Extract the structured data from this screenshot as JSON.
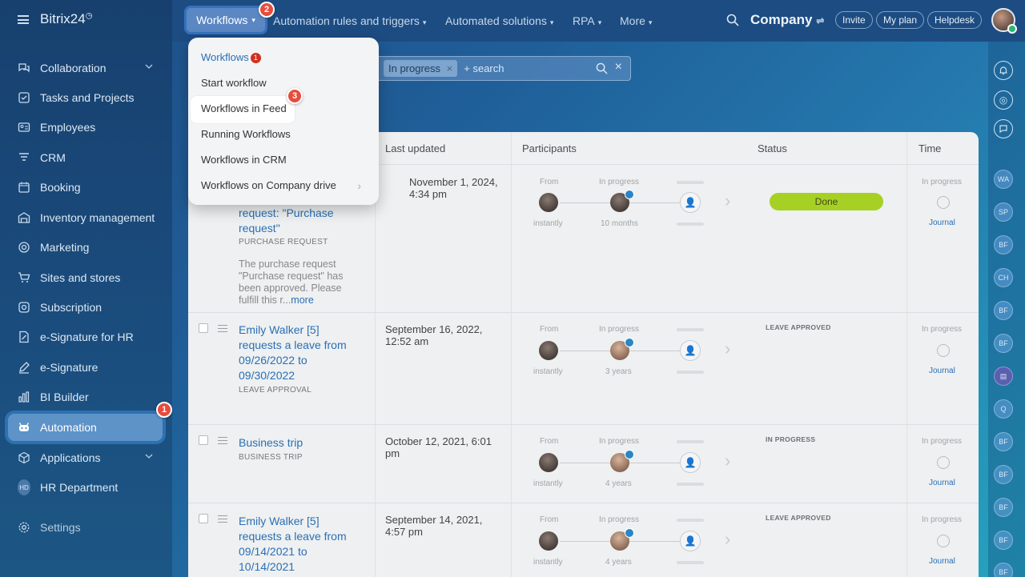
{
  "app": {
    "name": "Bitrix24"
  },
  "sidebar": {
    "items": [
      {
        "label": "Collaboration",
        "icon": "chat-bubbles-icon",
        "has_chevron": true
      },
      {
        "label": "Tasks and Projects",
        "icon": "checkbox-icon"
      },
      {
        "label": "Employees",
        "icon": "id-card-icon"
      },
      {
        "label": "CRM",
        "icon": "funnel-icon"
      },
      {
        "label": "Booking",
        "icon": "calendar-icon"
      },
      {
        "label": "Inventory management",
        "icon": "warehouse-icon"
      },
      {
        "label": "Marketing",
        "icon": "target-icon"
      },
      {
        "label": "Sites and stores",
        "icon": "cart-icon"
      },
      {
        "label": "Subscription",
        "icon": "subscription-icon"
      },
      {
        "label": "e-Signature for HR",
        "icon": "document-sign-icon"
      },
      {
        "label": "e-Signature",
        "icon": "pen-icon"
      },
      {
        "label": "BI Builder",
        "icon": "bar-chart-icon"
      },
      {
        "label": "Automation",
        "icon": "robot-icon",
        "active": true
      },
      {
        "label": "Applications",
        "icon": "cube-icon",
        "has_chevron": true
      },
      {
        "label": "HR Department",
        "icon": "hd-avatar",
        "badge": "HD"
      },
      {
        "label": "Settings",
        "icon": "gear-icon"
      }
    ]
  },
  "topbar": {
    "tabs": [
      {
        "label": "Workflows"
      },
      {
        "label": "Automation rules and triggers"
      },
      {
        "label": "Automated solutions"
      },
      {
        "label": "RPA"
      },
      {
        "label": "More"
      }
    ],
    "company": "Company",
    "buttons": {
      "invite": "Invite",
      "plan": "My plan",
      "helpdesk": "Helpdesk"
    }
  },
  "steps": {
    "one": "1",
    "two": "2",
    "three": "3"
  },
  "filter": {
    "chip": "In progress",
    "placeholder": "+ search"
  },
  "menu": {
    "items": [
      {
        "label": "Workflows",
        "count": "1"
      },
      {
        "label": "Start workflow"
      },
      {
        "label": "Workflows in Feed"
      },
      {
        "label": "Running Workflows"
      },
      {
        "label": "Workflows in CRM"
      },
      {
        "label": "Workflows on Company drive"
      }
    ]
  },
  "table": {
    "headers": {
      "updated": "Last updated",
      "participants": "Participants",
      "status": "Status",
      "time": "Time"
    },
    "labels": {
      "from": "From",
      "in_progress": "In progress",
      "instantly": "instantly",
      "journal": "Journal"
    },
    "rows": [
      {
        "title": "request: \"Purchase request\"",
        "type": "PURCHASE REQUEST",
        "desc": "The purchase request \"Purchase request\" has been approved. Please fulfill this r...",
        "more": "more",
        "date": "November 1, 2024, 4:34 pm",
        "duration": "10 months",
        "status": "Done"
      },
      {
        "title": "Emily Walker [5] requests a leave from 09/26/2022 to 09/30/2022",
        "type": "LEAVE APPROVAL",
        "date": "September 16, 2022, 12:52 am",
        "duration": "3 years",
        "status": "LEAVE APPROVED"
      },
      {
        "title": "Business trip",
        "type": "BUSINESS TRIP",
        "date": "October 12, 2021, 6:01 pm",
        "duration": "4 years",
        "status": "IN PROGRESS"
      },
      {
        "title": "Emily Walker [5] requests a leave from 09/14/2021 to 10/14/2021",
        "date": "September 14, 2021, 4:57 pm",
        "duration": "4 years",
        "status": "LEAVE APPROVED"
      }
    ]
  },
  "rail": {
    "avatars": [
      "WA",
      "SP",
      "BF",
      "CH",
      "BF",
      "BF",
      "",
      "Q",
      "BF",
      "BF",
      "BF",
      "BF",
      "BF"
    ]
  }
}
